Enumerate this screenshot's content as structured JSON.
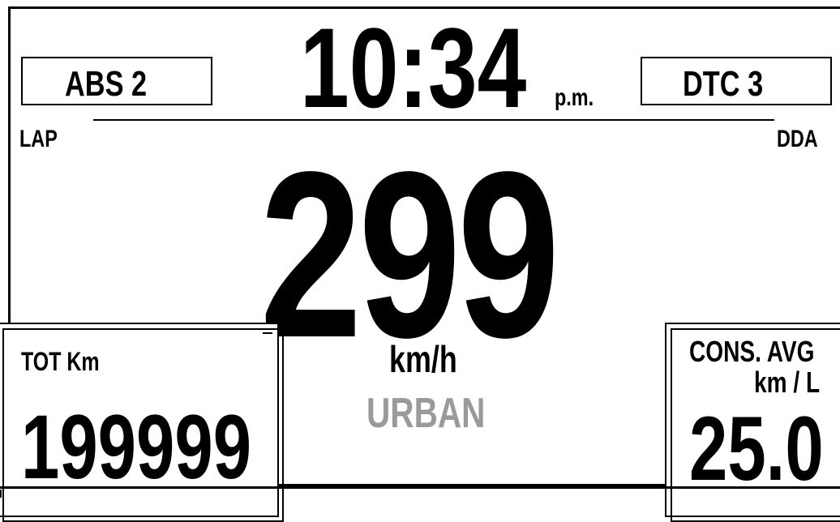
{
  "header": {
    "abs_label": "ABS 2",
    "dtc_label": "DTC 3",
    "clock_time": "10:34",
    "clock_meridiem": "p.m."
  },
  "side_labels": {
    "left": "LAP",
    "right": "DDA"
  },
  "speed": {
    "value": "299",
    "unit": "km/h",
    "mode": "URBAN",
    "mode_color": "#9a9a9a"
  },
  "odometer": {
    "label": "TOT Km",
    "value": "199999"
  },
  "consumption": {
    "label": "CONS. AVG",
    "unit": "km / L",
    "value": "25.0"
  }
}
